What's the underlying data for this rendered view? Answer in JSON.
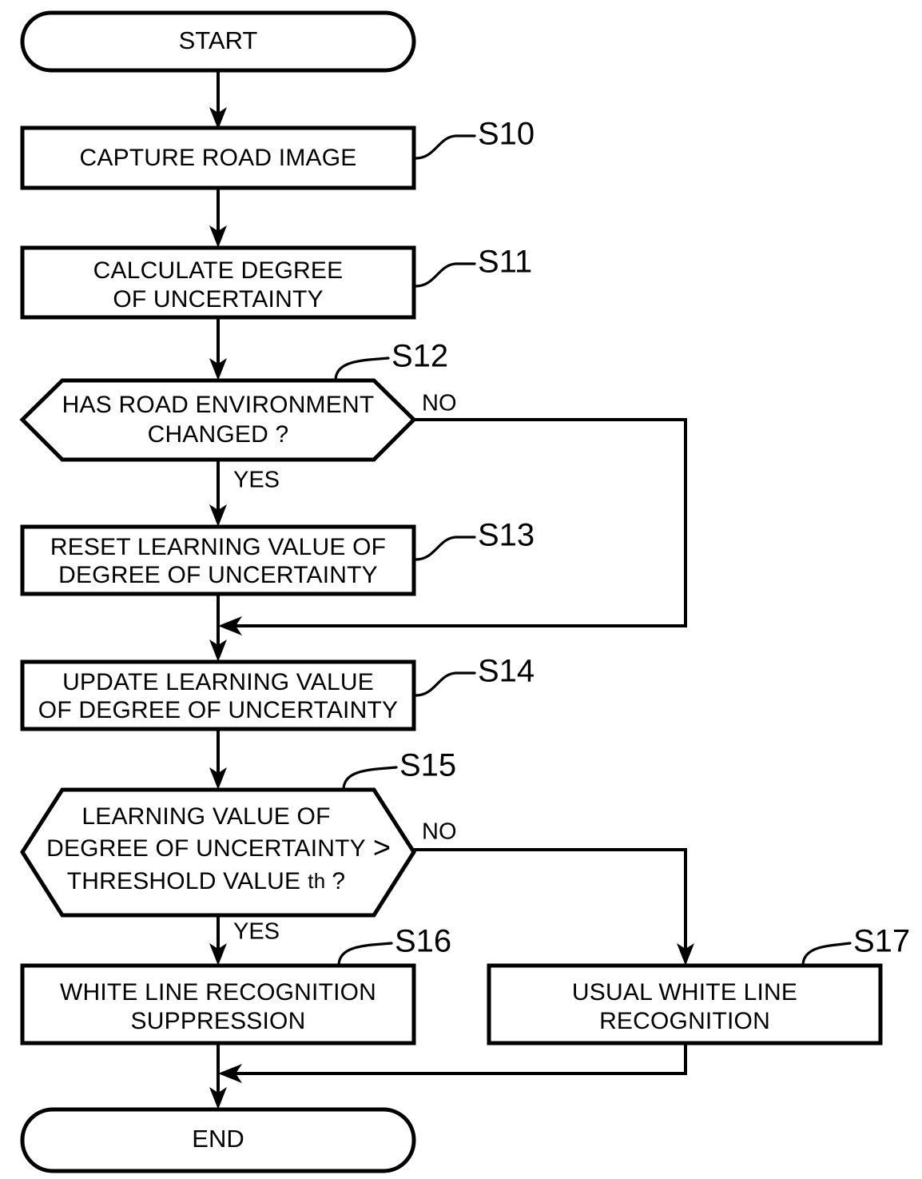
{
  "diagram": {
    "type": "flowchart",
    "title": "White line recognition control flowchart",
    "orientation": "top-to-bottom",
    "line_color": "#000000",
    "fill_color": "#ffffff",
    "background": "#ffffff"
  },
  "nodes": [
    {
      "id": "start",
      "shape": "terminator",
      "label": "START",
      "lines": [
        "START"
      ],
      "ref": null
    },
    {
      "id": "s10",
      "shape": "process",
      "label": "CAPTURE ROAD IMAGE",
      "lines": [
        "CAPTURE ROAD IMAGE"
      ],
      "ref": "S10"
    },
    {
      "id": "s11",
      "shape": "process",
      "label": "CALCULATE DEGREE OF UNCERTAINTY",
      "lines": [
        "CALCULATE DEGREE",
        "OF UNCERTAINTY"
      ],
      "ref": "S11"
    },
    {
      "id": "s12",
      "shape": "hexagon-decision",
      "label": "HAS ROAD ENVIRONMENT CHANGED ?",
      "lines": [
        "HAS ROAD ENVIRONMENT",
        "CHANGED ?"
      ],
      "ref": "S12"
    },
    {
      "id": "s13",
      "shape": "process",
      "label": "RESET LEARNING VALUE OF DEGREE OF UNCERTAINTY",
      "lines": [
        "RESET LEARNING VALUE OF",
        "DEGREE OF UNCERTAINTY"
      ],
      "ref": "S13"
    },
    {
      "id": "s14",
      "shape": "process",
      "label": "UPDATE LEARNING VALUE OF DEGREE OF UNCERTAINTY",
      "lines": [
        "UPDATE LEARNING VALUE",
        "OF DEGREE OF UNCERTAINTY"
      ],
      "ref": "S14"
    },
    {
      "id": "s15",
      "shape": "hexagon-decision",
      "label": "LEARNING VALUE OF DEGREE OF UNCERTAINTY > THRESHOLD VALUE th ?",
      "lines": [
        "LEARNING VALUE OF",
        "DEGREE OF UNCERTAINTY",
        "THRESHOLD VALUE"
      ],
      "comparison_operator": ">",
      "threshold_token": "th",
      "question_mark": "?",
      "ref": "S15"
    },
    {
      "id": "s16",
      "shape": "process",
      "label": "WHITE LINE RECOGNITION SUPPRESSION",
      "lines": [
        "WHITE LINE RECOGNITION",
        "SUPPRESSION"
      ],
      "ref": "S16"
    },
    {
      "id": "s17",
      "shape": "process",
      "label": "USUAL WHITE LINE RECOGNITION",
      "lines": [
        "USUAL WHITE LINE",
        "RECOGNITION"
      ],
      "ref": "S17"
    },
    {
      "id": "end",
      "shape": "terminator",
      "label": "END",
      "lines": [
        "END"
      ],
      "ref": null
    }
  ],
  "branch_labels": {
    "s12_no": "NO",
    "s12_yes": "YES",
    "s15_no": "NO",
    "s15_yes": "YES"
  },
  "reference_numerals": {
    "s10": "S10",
    "s11": "S11",
    "s12": "S12",
    "s13": "S13",
    "s14": "S14",
    "s15": "S15",
    "s16": "S16",
    "s17": "S17"
  },
  "edges": [
    {
      "from": "start",
      "to": "s10",
      "label": ""
    },
    {
      "from": "s10",
      "to": "s11",
      "label": ""
    },
    {
      "from": "s11",
      "to": "s12",
      "label": ""
    },
    {
      "from": "s12",
      "to": "s13",
      "label": "YES"
    },
    {
      "from": "s12",
      "to": "s14",
      "label": "NO"
    },
    {
      "from": "s13",
      "to": "s14",
      "label": ""
    },
    {
      "from": "s14",
      "to": "s15",
      "label": ""
    },
    {
      "from": "s15",
      "to": "s16",
      "label": "YES"
    },
    {
      "from": "s15",
      "to": "s17",
      "label": "NO"
    },
    {
      "from": "s16",
      "to": "end",
      "label": ""
    },
    {
      "from": "s17",
      "to": "end",
      "label": ""
    }
  ]
}
